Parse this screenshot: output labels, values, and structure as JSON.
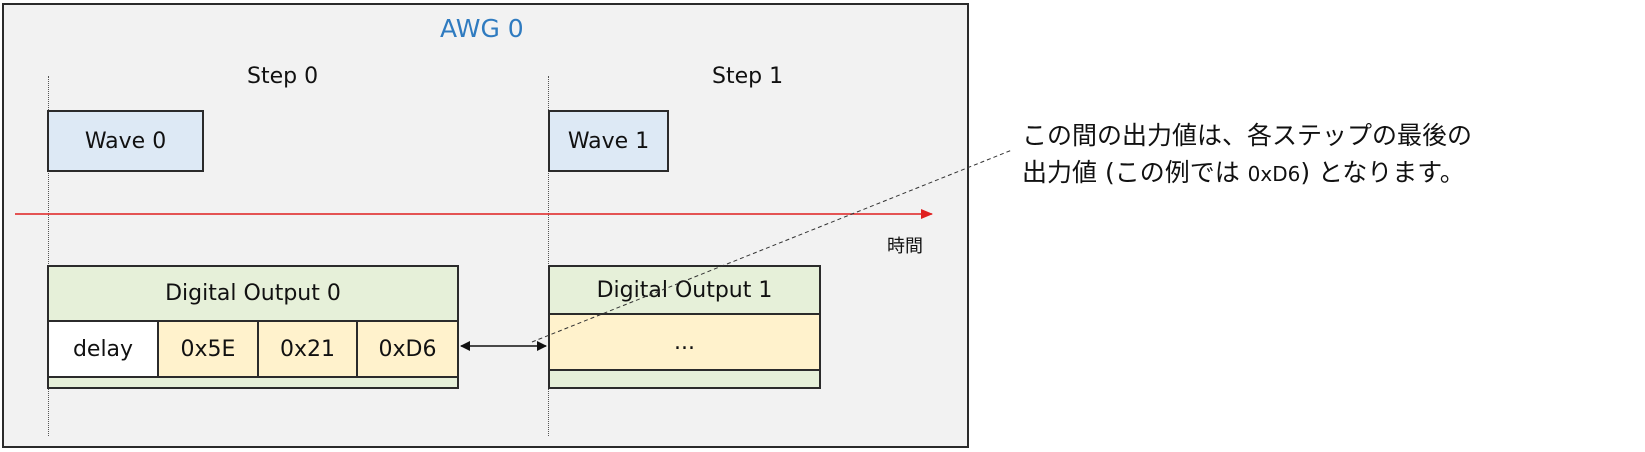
{
  "title": "AWG 0",
  "steps": [
    {
      "label": "Step 0",
      "wave": "Wave 0",
      "output": "Digital Output 0"
    },
    {
      "label": "Step 1",
      "wave": "Wave 1",
      "output": "Digital Output 1"
    }
  ],
  "output0_cells": [
    "delay",
    "0x5E",
    "0x21",
    "0xD6"
  ],
  "output1_cell": "...",
  "time_label": "時間",
  "note": {
    "line1": "この間の出力値は、各ステップの最後の",
    "line2_before": "出力値 (この例では ",
    "line2_value": "0xD6",
    "line2_after": ") となります。"
  },
  "colors": {
    "title": "#2f7bc0",
    "time_arrow": "#e02020",
    "wave_fill": "#dde9f5",
    "output_header_fill": "#e6f0d9",
    "output_cell_fill": "#fff2cc"
  }
}
